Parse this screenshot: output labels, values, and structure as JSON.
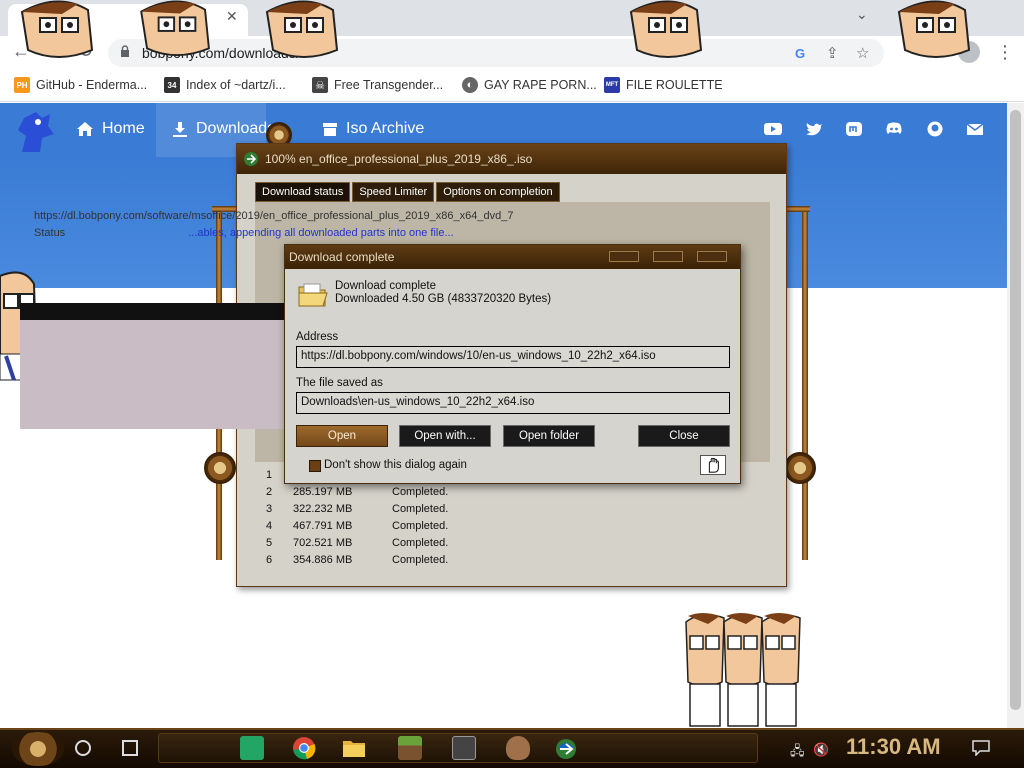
{
  "browser": {
    "close_tab_glyph": "✕",
    "tabs_dropdown_glyph": "⌄",
    "back_glyph": "←",
    "forward_glyph": "→",
    "reload_glyph": "↻",
    "url": "bobpony.com/downloads/",
    "share_glyph": "⇪",
    "star_glyph": "☆",
    "menu_glyph": "⋮",
    "bookmarks": [
      {
        "label": "GitHub - Enderma...",
        "icon": "ph-icon",
        "fav_text": "PH",
        "color": "#f7971d"
      },
      {
        "label": "Index of ~dartz/i...",
        "icon": "pixel-icon",
        "fav_text": "34",
        "color": "#333333"
      },
      {
        "label": "Free Transgender...",
        "icon": "skull-icon",
        "fav_text": "☠",
        "color": "#444444"
      },
      {
        "label": "GAY RAPE PORN...",
        "icon": "globe-icon",
        "fav_text": "◐",
        "color": "#666666"
      },
      {
        "label": "FILE ROULETTE",
        "icon": "mft-icon",
        "fav_text": "MFT",
        "color": "#2b3aa8"
      }
    ]
  },
  "site": {
    "nav": [
      {
        "label": "Home",
        "icon": "home-icon"
      },
      {
        "label": "Downloads",
        "icon": "download-icon"
      },
      {
        "label": "Iso Archive",
        "icon": "archive-icon"
      }
    ],
    "social_icons": [
      "youtube-icon",
      "twitter-icon",
      "mastodon-icon",
      "discord-icon",
      "github-icon",
      "mail-icon"
    ],
    "nav_color": "#3a7bd5"
  },
  "idm": {
    "title": "100% en_office_professional_plus_2019_x86_.iso",
    "tabs": [
      "Download status",
      "Speed Limiter",
      "Options on completion"
    ],
    "url_line": "https://dl.bobpony.com/software/msoffice/2019/en_office_professional_plus_2019_x86_x64_dvd_7",
    "status_label": "Status",
    "status_text": "...ables, appending all downloaded parts into one file...",
    "connections": [
      {
        "n": "1",
        "size": "",
        "status": ""
      },
      {
        "n": "2",
        "size": "285.197  MB",
        "status": "Completed."
      },
      {
        "n": "3",
        "size": "322.232  MB",
        "status": "Completed."
      },
      {
        "n": "4",
        "size": "467.791  MB",
        "status": "Completed."
      },
      {
        "n": "5",
        "size": "702.521  MB",
        "status": "Completed."
      },
      {
        "n": "6",
        "size": "354.886  MB",
        "status": "Completed."
      }
    ]
  },
  "dialog": {
    "title": "Download complete",
    "line1": "Download complete",
    "line2": "Downloaded 4.50  GB (4833720320 Bytes)",
    "address_label": "Address",
    "address_value": "https://dl.bobpony.com/windows/10/en-us_windows_10_22h2_x64.iso",
    "saved_label": "The file saved as",
    "saved_value": "Downloads\\en-us_windows_10_22h2_x64.iso",
    "buttons": {
      "open": "Open",
      "open_with": "Open with...",
      "open_folder": "Open folder",
      "close": "Close"
    },
    "checkbox_label": "Don't show this dialog again"
  },
  "taskbar": {
    "clock": "11:30 AM",
    "apps": [
      "sheets-icon",
      "chrome-icon",
      "file-explorer-icon",
      "minecraft-icon",
      "terminal-icon",
      "animal-icon",
      "idm-icon"
    ],
    "accent": "#d7b97f"
  }
}
